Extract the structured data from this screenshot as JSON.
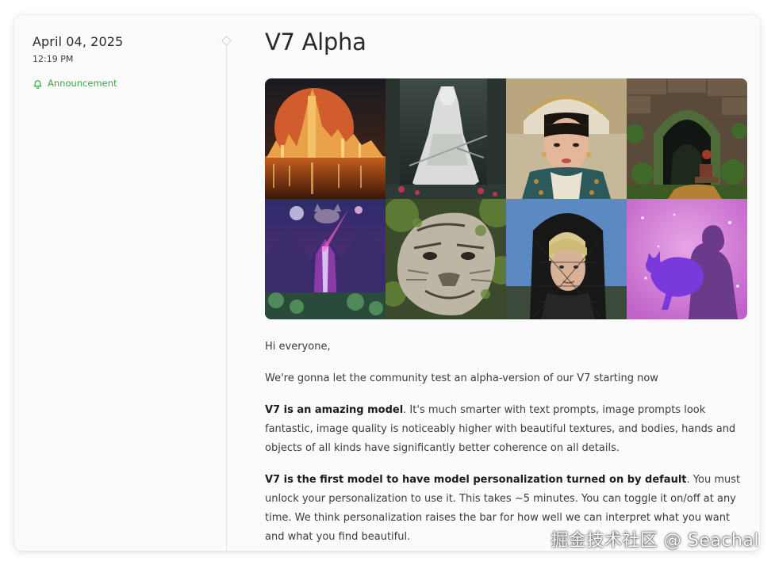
{
  "post": {
    "date": "April 04, 2025",
    "time": "12:19 PM",
    "category": "Announcement",
    "title": "V7 Alpha"
  },
  "hero_images": [
    {
      "id": "tile-city-red-moon",
      "subject": "golden city under red moon"
    },
    {
      "id": "tile-white-samurai",
      "subject": "white-robed swordsman"
    },
    {
      "id": "tile-woman-headdress",
      "subject": "woman in embroidered headdress"
    },
    {
      "id": "tile-stone-arch",
      "subject": "rider at mossy stone arch"
    },
    {
      "id": "tile-psychedelic-mountain",
      "subject": "cosmic cat over violet peaks"
    },
    {
      "id": "tile-stone-tiger",
      "subject": "mossy stone tiger face"
    },
    {
      "id": "tile-veiled-man",
      "subject": "blond man in lace veil"
    },
    {
      "id": "tile-pink-silhouette",
      "subject": "silhouette holding purple cat"
    }
  ],
  "body": {
    "greeting": "Hi everyone,",
    "intro": "We're gonna let the community test an alpha-version of our V7 starting now",
    "p1_bold": "V7 is an amazing model",
    "p1_rest": ". It's much smarter with text prompts, image prompts look fantastic, image quality is noticeably higher with beautiful textures, and bodies, hands and objects of all kinds have significantly better coherence on all details.",
    "p2_bold": "V7 is the first model to have model personalization turned on by default",
    "p2_rest": ". You must unlock your personalization to use it. This takes ~5 minutes. You can toggle it on/off at any time. We think personalization raises the bar for how well we can interpret what you want and what you find beautiful."
  },
  "watermark": "掘金技术社区 @ Seachal",
  "colors": {
    "accent_green": "#3aa83a",
    "text_dark": "#2a2a2a",
    "card_bg": "#fbfbfc"
  }
}
